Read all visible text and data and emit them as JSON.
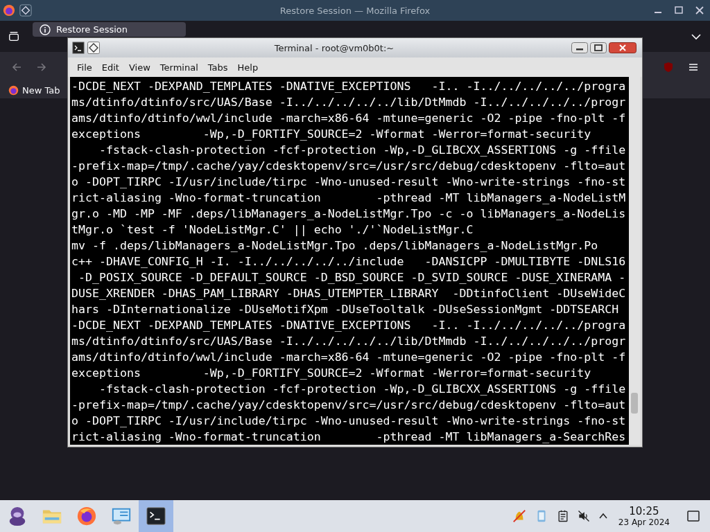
{
  "firefox": {
    "title": "Restore Session — Mozilla Firefox",
    "tabs": [
      {
        "label": "Restore Session",
        "selected": true
      }
    ],
    "bookmarks": [
      {
        "label": "New Tab"
      }
    ]
  },
  "terminal": {
    "title": "Terminal - root@vm0b0t:~",
    "menu": [
      "File",
      "Edit",
      "View",
      "Terminal",
      "Tabs",
      "Help"
    ],
    "lines": [
      "-DCDE_NEXT -DEXPAND_TEMPLATES -DNATIVE_EXCEPTIONS   -I.. -I../../../../../progra",
      "ms/dtinfo/dtinfo/src/UAS/Base -I../../../../../lib/DtMmdb -I../../../../../progr",
      "ams/dtinfo/dtinfo/wwl/include -march=x86-64 -mtune=generic -O2 -pipe -fno-plt -f",
      "exceptions         -Wp,-D_FORTIFY_SOURCE=2 -Wformat -Werror=format-security",
      "    -fstack-clash-protection -fcf-protection -Wp,-D_GLIBCXX_ASSERTIONS -g -ffile",
      "-prefix-map=/tmp/.cache/yay/cdesktopenv/src=/usr/src/debug/cdesktopenv -flto=aut",
      "o -DOPT_TIRPC -I/usr/include/tirpc -Wno-unused-result -Wno-write-strings -fno-st",
      "rict-aliasing -Wno-format-truncation        -pthread -MT libManagers_a-NodeListM",
      "gr.o -MD -MP -MF .deps/libManagers_a-NodeListMgr.Tpo -c -o libManagers_a-NodeLis",
      "tMgr.o `test -f 'NodeListMgr.C' || echo './'`NodeListMgr.C",
      "mv -f .deps/libManagers_a-NodeListMgr.Tpo .deps/libManagers_a-NodeListMgr.Po",
      "c++ -DHAVE_CONFIG_H -I. -I../../../../../include   -DANSICPP -DMULTIBYTE -DNLS16",
      " -D_POSIX_SOURCE -D_DEFAULT_SOURCE -D_BSD_SOURCE -D_SVID_SOURCE -DUSE_XINERAMA -",
      "DUSE_XRENDER -DHAS_PAM_LIBRARY -DHAS_UTEMPTER_LIBRARY  -DDtinfoClient -DUseWideC",
      "hars -DInternationalize -DUseMotifXpm -DUseTooltalk -DUseSessionMgmt -DDTSEARCH",
      "-DCDE_NEXT -DEXPAND_TEMPLATES -DNATIVE_EXCEPTIONS   -I.. -I../../../../../progra",
      "ms/dtinfo/dtinfo/src/UAS/Base -I../../../../../lib/DtMmdb -I../../../../../progr",
      "ams/dtinfo/dtinfo/wwl/include -march=x86-64 -mtune=generic -O2 -pipe -fno-plt -f",
      "exceptions         -Wp,-D_FORTIFY_SOURCE=2 -Wformat -Werror=format-security",
      "    -fstack-clash-protection -fcf-protection -Wp,-D_GLIBCXX_ASSERTIONS -g -ffile",
      "-prefix-map=/tmp/.cache/yay/cdesktopenv/src=/usr/src/debug/cdesktopenv -flto=aut",
      "o -DOPT_TIRPC -I/usr/include/tirpc -Wno-unused-result -Wno-write-strings -fno-st",
      "rict-aliasing -Wno-format-truncation        -pthread -MT libManagers_a-SearchRes"
    ]
  },
  "taskbar": {
    "apps": [
      {
        "kind": "mascot",
        "selected": false
      },
      {
        "kind": "folder",
        "selected": false
      },
      {
        "kind": "browser",
        "selected": false
      },
      {
        "kind": "monitor",
        "selected": false
      },
      {
        "kind": "terminal",
        "selected": true
      }
    ],
    "clock": {
      "time": "10:25",
      "date": "23 Apr 2024"
    }
  }
}
